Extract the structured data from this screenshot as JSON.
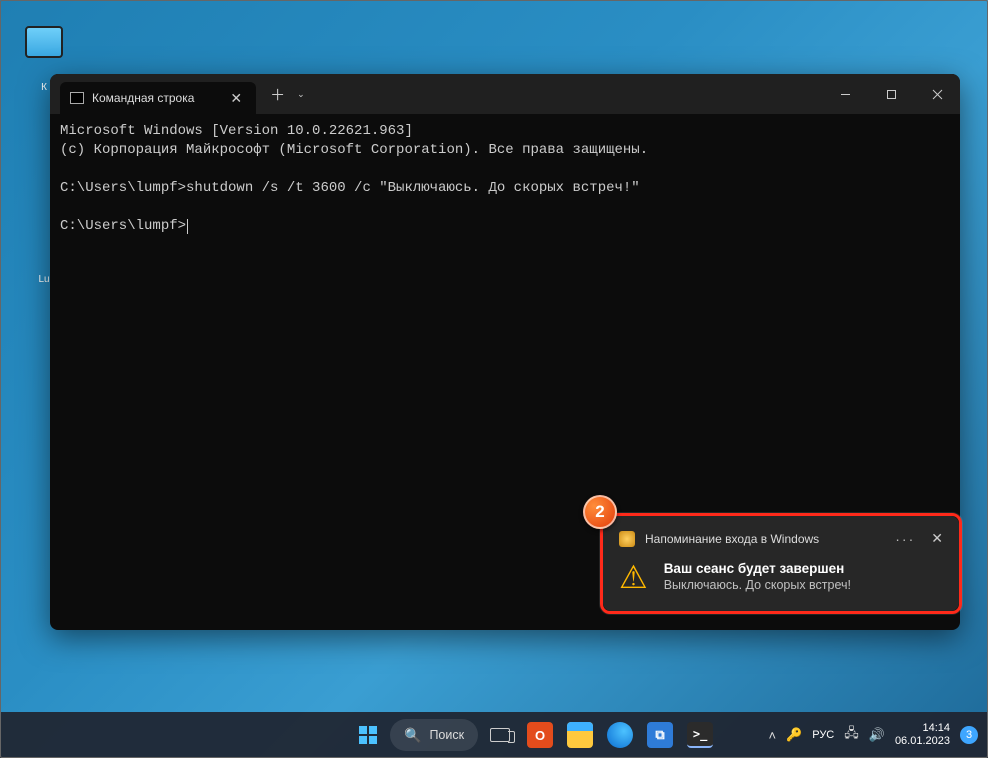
{
  "desktop": {
    "icons": [
      {
        "label": ""
      },
      {
        "label": "К"
      },
      {
        "label": "Lu"
      }
    ]
  },
  "terminal": {
    "tab_title": "Командная строка",
    "lines": {
      "l1": "Microsoft Windows [Version 10.0.22621.963]",
      "l2": "(c) Корпорация Майкрософт (Microsoft Corporation). Все права защищены.",
      "l3": "",
      "l4": "C:\\Users\\lumpf>shutdown /s /t 3600 /c \"Выключаюсь. До скорых встреч!\"",
      "l5": "",
      "prompt": "C:\\Users\\lumpf>"
    }
  },
  "notification": {
    "app": "Напоминание входа в Windows",
    "title": "Ваш сеанс будет завершен",
    "message": "Выключаюсь. До скорых встреч!"
  },
  "callout": "2",
  "taskbar": {
    "search": "Поиск",
    "lang": "РУС",
    "time": "14:14",
    "date": "06.01.2023",
    "notif_count": "3"
  }
}
